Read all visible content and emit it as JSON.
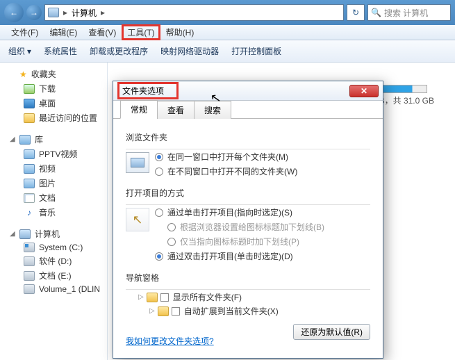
{
  "nav": {
    "address": "计算机",
    "sep1": "▸",
    "sep2": "▸",
    "search_placeholder": "搜索 计算机"
  },
  "menu": {
    "file": "文件(F)",
    "edit": "编辑(E)",
    "view": "查看(V)",
    "tools": "工具(T)",
    "help": "帮助(H)"
  },
  "toolbar": {
    "organize": "组织",
    "sysprop": "系统属性",
    "uninstall": "卸载或更改程序",
    "mapnet": "映射网络驱动器",
    "ctrlpanel": "打开控制面板"
  },
  "sidebar": {
    "fav": {
      "head": "收藏夹",
      "items": [
        "下载",
        "桌面",
        "最近访问的位置"
      ]
    },
    "lib": {
      "head": "库",
      "items": [
        "PPTV视频",
        "视频",
        "图片",
        "文档",
        "音乐"
      ]
    },
    "pc": {
      "head": "计算机",
      "items": [
        "System (C:)",
        "软件 (D:)",
        "文档 (E:)",
        "Volume_1 (DLIN"
      ]
    }
  },
  "main": {
    "disk_total": "，共 31.0 GB",
    "disk_label_suffix": "B"
  },
  "dialog": {
    "title": "文件夹选项",
    "tabs": {
      "general": "常规",
      "view": "查看",
      "search": "搜索"
    },
    "browse": {
      "label": "浏览文件夹",
      "opt_same": "在同一窗口中打开每个文件夹(M)",
      "opt_diff": "在不同窗口中打开不同的文件夹(W)"
    },
    "open": {
      "label": "打开项目的方式",
      "single": "通过单击打开项目(指向时选定)(S)",
      "under_browser": "根据浏览器设置给图标标题加下划线(B)",
      "under_point": "仅当指向图标标题时加下划线(P)",
      "double": "通过双击打开项目(单击时选定)(D)"
    },
    "navpane": {
      "label": "导航窗格",
      "show_all": "显示所有文件夹(F)",
      "auto_expand": "自动扩展到当前文件夹(X)"
    },
    "restore": "还原为默认值(R)",
    "help_link": "我如何更改文件夹选项?"
  }
}
